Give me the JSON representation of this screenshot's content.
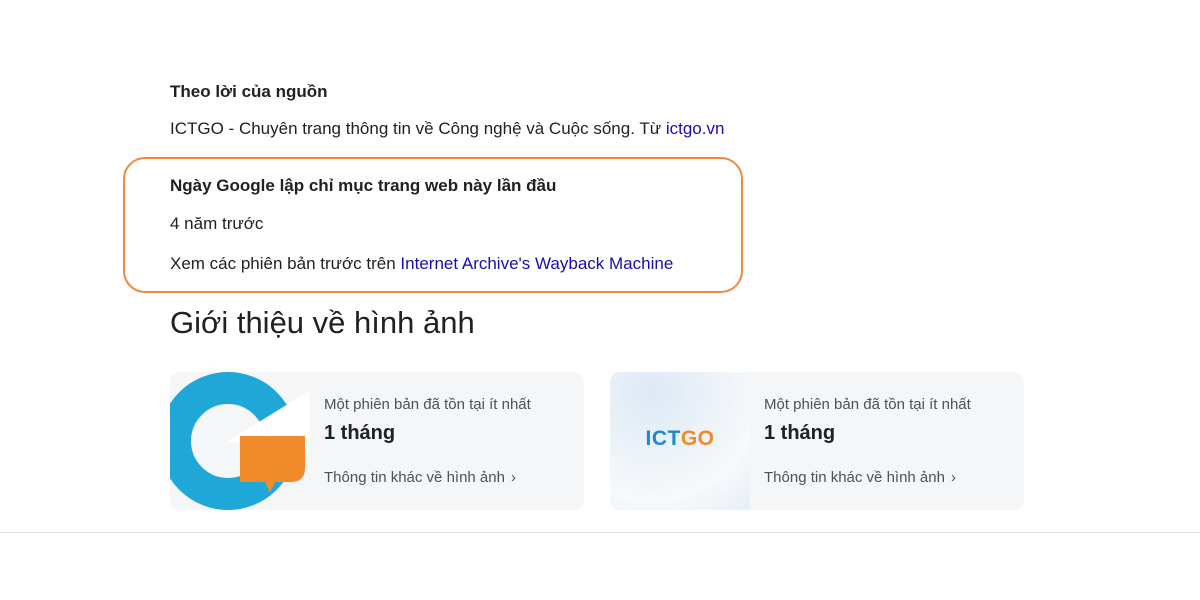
{
  "source": {
    "heading": "Theo lời của nguồn",
    "description": "ICTGO - Chuyên trang thông tin về Công nghệ và Cuộc sống. Từ ",
    "domain_link": "ictgo.vn"
  },
  "indexing": {
    "heading": "Ngày Google lập chỉ mục trang web này lần đầu",
    "value": "4 năm trước",
    "wayback_prefix": "Xem các phiên bản trước trên ",
    "wayback_link": "Internet Archive's Wayback Machine"
  },
  "images": {
    "heading": "Giới thiệu về hình ảnh",
    "cards": [
      {
        "subtitle": "Một phiên bản đã tồn tại ít nhất",
        "value": "1 tháng",
        "more_label": "Thông tin khác về hình ảnh",
        "thumbnail_icon": "ictgo-g-logo"
      },
      {
        "subtitle": "Một phiên bản đã tồn tại ít nhất",
        "value": "1 tháng",
        "more_label": "Thông tin khác về hình ảnh",
        "thumbnail_text_part1": "ICT",
        "thumbnail_text_part2": "GO"
      }
    ]
  },
  "colors": {
    "link": "#1a0dab",
    "highlight_border": "#f0883e",
    "logo_blue": "#1fa7d8",
    "logo_orange": "#f08a2a",
    "card_bg": "#f5f6f8"
  }
}
